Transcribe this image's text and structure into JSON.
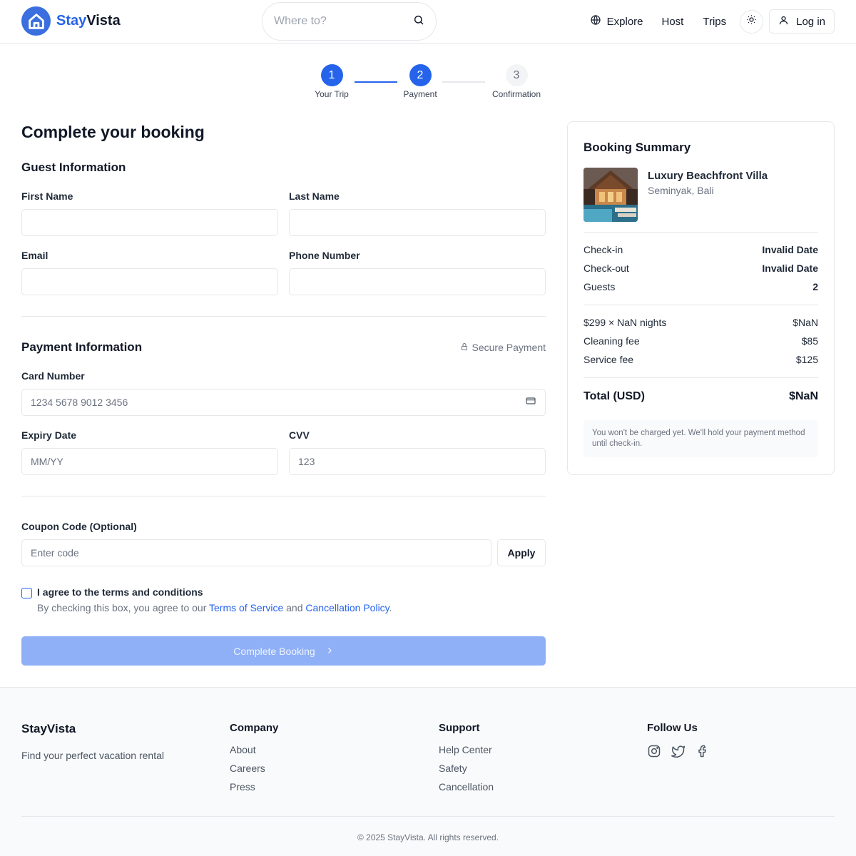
{
  "brand": {
    "name_part1": "Stay",
    "name_part2": "Vista",
    "accent": "#2563eb"
  },
  "header": {
    "search_placeholder": "Where to?",
    "nav": {
      "explore": "Explore",
      "host": "Host",
      "trips": "Trips",
      "login": "Log in"
    },
    "icons": {
      "globe": "globe-icon",
      "search": "search-icon",
      "theme": "sun-icon",
      "user": "user-icon"
    }
  },
  "stepper": {
    "steps": [
      {
        "number": "1",
        "label": "Your Trip",
        "state": "active"
      },
      {
        "number": "2",
        "label": "Payment",
        "state": "active"
      },
      {
        "number": "3",
        "label": "Confirmation",
        "state": "inactive"
      }
    ]
  },
  "form": {
    "title": "Complete your booking",
    "guest_section": "Guest Information",
    "first_name_label": "First Name",
    "last_name_label": "Last Name",
    "email_label": "Email",
    "phone_label": "Phone Number",
    "first_name_value": "",
    "last_name_value": "",
    "email_value": "",
    "phone_value": "",
    "payment_section": "Payment Information",
    "secure_label": "Secure Payment",
    "card_label": "Card Number",
    "card_placeholder": "1234 5678 9012 3456",
    "expiry_label": "Expiry Date",
    "expiry_placeholder": "MM/YY",
    "cvv_label": "CVV",
    "cvv_placeholder": "123",
    "coupon_label": "Coupon Code (Optional)",
    "coupon_placeholder": "Enter code",
    "apply_label": "Apply",
    "terms_title": "I agree to the terms and conditions",
    "terms_prefix": "By checking this box, you agree to our",
    "terms_link1": "Terms of Service",
    "terms_and": "and",
    "terms_link2": "Cancellation Policy",
    "terms_suffix": ".",
    "terms_checked": false,
    "submit_label": "Complete Booking"
  },
  "summary": {
    "title": "Booking Summary",
    "property_name": "Luxury Beachfront Villa",
    "property_location": "Seminyak, Bali",
    "checkin_label": "Check-in",
    "checkin_value": "Invalid Date",
    "checkout_label": "Check-out",
    "checkout_value": "Invalid Date",
    "guests_label": "Guests",
    "guests_value": "2",
    "nights_label": "$299 × NaN nights",
    "nights_value": "$NaN",
    "cleaning_label": "Cleaning fee",
    "cleaning_value": "$85",
    "service_label": "Service fee",
    "service_value": "$125",
    "total_label": "Total (USD)",
    "total_value": "$NaN",
    "note": "You won't be charged yet. We'll hold your payment method until check-in."
  },
  "footer": {
    "brand": "StayVista",
    "tagline": "Find your perfect vacation rental",
    "company_title": "Company",
    "company_links": [
      "About",
      "Careers",
      "Press"
    ],
    "support_title": "Support",
    "support_links": [
      "Help Center",
      "Safety",
      "Cancellation"
    ],
    "follow_title": "Follow Us",
    "social_icons": [
      "instagram-icon",
      "twitter-icon",
      "facebook-icon"
    ],
    "copyright": "© 2025 StayVista. All rights reserved."
  }
}
